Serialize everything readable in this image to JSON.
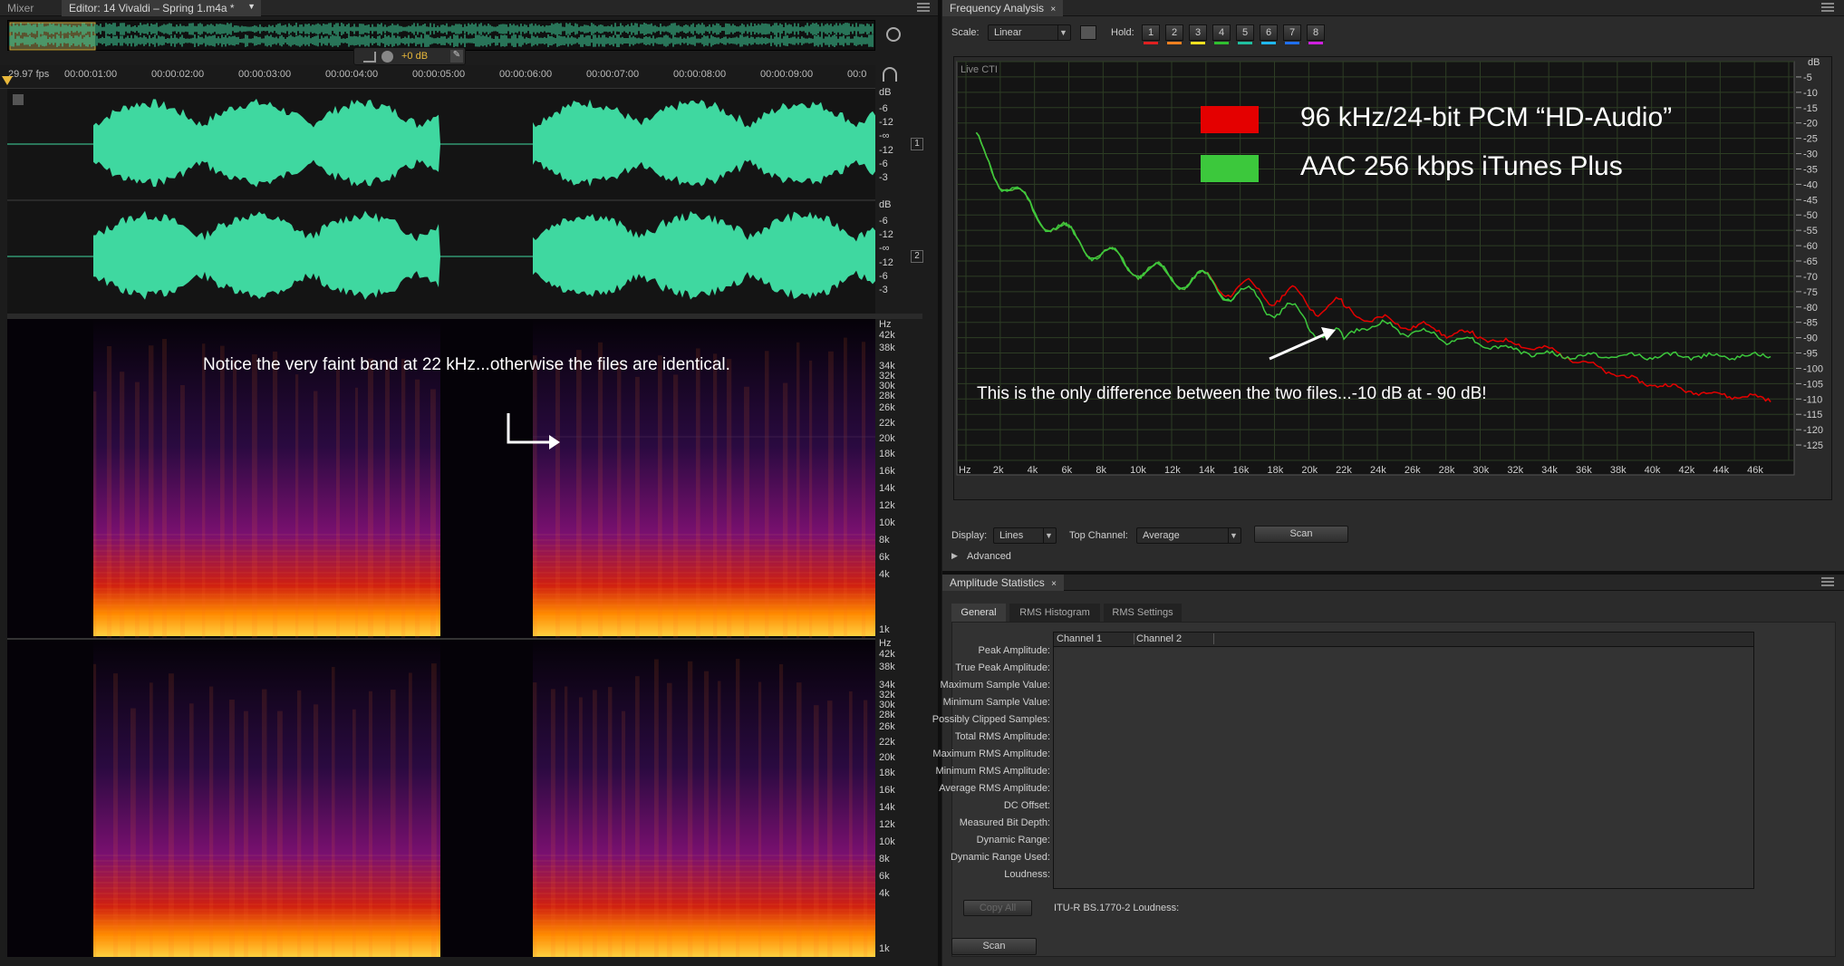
{
  "editor": {
    "tabs": [
      {
        "label": "Mixer"
      },
      {
        "label": "Editor: 14 Vivaldi – Spring 1.m4a *"
      }
    ],
    "hud_gain": "+0 dB",
    "fps_label": "29.97 fps",
    "timeline_labels": [
      "00:00:01:00",
      "00:00:02:00",
      "00:00:03:00",
      "00:00:04:00",
      "00:00:05:00",
      "00:00:06:00",
      "00:00:07:00",
      "00:00:08:00",
      "00:00:09:00",
      "00:0"
    ],
    "db_unit": "dB",
    "channel1_db_ticks": [
      "-6",
      "-12",
      "-∞",
      "-12",
      "-6",
      "-3"
    ],
    "channel2_db_ticks": [
      "-6",
      "-12",
      "-∞",
      "-12",
      "-6",
      "-3"
    ],
    "channel_badges": [
      "1",
      "2"
    ],
    "hz_unit": "Hz",
    "hz_ticks": [
      "42k",
      "38k",
      "34k",
      "32k",
      "30k",
      "28k",
      "26k",
      "22k",
      "20k",
      "18k",
      "16k",
      "14k",
      "12k",
      "10k",
      "8k",
      "6k",
      "4k",
      "1k"
    ],
    "annotation_text": "Notice the very faint band at 22 kHz...otherwise the files are identical."
  },
  "frequency_analysis": {
    "title": "Frequency Analysis",
    "scale_label": "Scale:",
    "scale_value": "Linear",
    "hold_label": "Hold:",
    "hold_buttons": [
      {
        "label": "1",
        "color": "#e02020"
      },
      {
        "label": "2",
        "color": "#f08020"
      },
      {
        "label": "3",
        "color": "#f0e020"
      },
      {
        "label": "4",
        "color": "#30c030"
      },
      {
        "label": "5",
        "color": "#20c0a0"
      },
      {
        "label": "6",
        "color": "#20b8f0"
      },
      {
        "label": "7",
        "color": "#2070f0"
      },
      {
        "label": "8",
        "color": "#d020e0"
      }
    ],
    "live_cti": "Live CTI",
    "legend": [
      {
        "label": "96 kHz/24-bit PCM “HD-Audio”",
        "color": "#e40000"
      },
      {
        "label": "AAC 256 kbps iTunes Plus",
        "color": "#3cc83c"
      }
    ],
    "annotation": "This is the only difference between the two files...-10 dB at - 90 dB!",
    "display_label": "Display:",
    "display_value": "Lines",
    "top_channel_label": "Top Channel:",
    "top_channel_value": "Average",
    "scan_label": "Scan",
    "advanced_label": "Advanced"
  },
  "chart_data": {
    "type": "line",
    "title": "",
    "xlabel": "",
    "ylabel": "dB",
    "x_unit_label": "Hz",
    "x_tick_labels": [
      "2k",
      "4k",
      "6k",
      "8k",
      "10k",
      "12k",
      "14k",
      "16k",
      "18k",
      "20k",
      "22k",
      "24k",
      "26k",
      "28k",
      "30k",
      "32k",
      "34k",
      "36k",
      "38k",
      "40k",
      "42k",
      "44k",
      "46k"
    ],
    "y_tick_labels": [
      "-5",
      "-10",
      "-15",
      "-20",
      "-25",
      "-30",
      "-35",
      "-40",
      "-45",
      "-50",
      "-55",
      "-60",
      "-65",
      "-70",
      "-75",
      "-80",
      "-85",
      "-90",
      "-95",
      "-100",
      "-105",
      "-110",
      "-115",
      "-120",
      "-125"
    ],
    "xlim": [
      0,
      48000
    ],
    "ylim": [
      -130,
      0
    ],
    "grid": true,
    "legend_position": "top-right",
    "series": [
      {
        "name": "96 kHz/24-bit PCM “HD-Audio”",
        "color": "#e40000",
        "x": [
          0,
          1000,
          2000,
          3000,
          4000,
          5000,
          6000,
          7000,
          8000,
          9000,
          10000,
          11000,
          12000,
          13000,
          14000,
          15000,
          16000,
          17000,
          18000,
          19000,
          20000,
          21000,
          22000,
          23000,
          24000,
          25000,
          26000,
          27000,
          28000,
          29000,
          30000,
          31000,
          32000,
          33000,
          34000,
          35000,
          36000,
          37000,
          38000,
          39000,
          40000,
          41000,
          42000,
          43000,
          44000,
          45000,
          46000,
          47000,
          48000
        ],
        "y": [
          -22,
          -30,
          -38,
          -44,
          -49,
          -53,
          -57,
          -60,
          -63,
          -65,
          -67,
          -69,
          -70,
          -71,
          -72,
          -73,
          -74,
          -75,
          -76,
          -77,
          -78,
          -80,
          -81,
          -83,
          -84,
          -85,
          -86,
          -87,
          -88,
          -89,
          -90,
          -91,
          -92,
          -93,
          -94,
          -96,
          -98,
          -100,
          -102,
          -104,
          -105,
          -106,
          -107,
          -108,
          -108.5,
          -109,
          -109.5,
          -110,
          -110.5
        ]
      },
      {
        "name": "AAC 256 kbps iTunes Plus",
        "color": "#3cc83c",
        "x": [
          0,
          1000,
          2000,
          3000,
          4000,
          5000,
          6000,
          7000,
          8000,
          9000,
          10000,
          11000,
          12000,
          13000,
          14000,
          15000,
          16000,
          17000,
          18000,
          19000,
          20000,
          21000,
          22000,
          23000,
          24000,
          25000,
          26000,
          27000,
          28000,
          29000,
          30000,
          31000,
          32000,
          33000,
          34000,
          35000,
          36000,
          37000,
          38000,
          39000,
          40000,
          41000,
          42000,
          43000,
          44000,
          45000,
          46000,
          47000,
          48000
        ],
        "y": [
          -22,
          -30,
          -38,
          -44,
          -49,
          -53,
          -57,
          -60,
          -63,
          -65,
          -67,
          -69,
          -70,
          -71,
          -72,
          -74,
          -76,
          -78,
          -80,
          -82,
          -85,
          -88,
          -92,
          -86,
          -86,
          -87,
          -88,
          -89,
          -90,
          -91,
          -92,
          -93,
          -94,
          -95,
          -95.5,
          -96,
          -96,
          -96,
          -96,
          -96,
          -96,
          -96,
          -96,
          -96,
          -96,
          -96,
          -96,
          -96,
          -96
        ]
      }
    ]
  },
  "amplitude_statistics": {
    "title": "Amplitude Statistics",
    "tabs": [
      "General",
      "RMS Histogram",
      "RMS Settings"
    ],
    "columns": [
      "Channel 1",
      "Channel 2"
    ],
    "rows": [
      "Peak Amplitude:",
      "True Peak Amplitude:",
      "Maximum Sample Value:",
      "Minimum Sample Value:",
      "Possibly Clipped Samples:",
      "Total RMS Amplitude:",
      "Maximum RMS Amplitude:",
      "Minimum RMS Amplitude:",
      "Average RMS Amplitude:",
      "DC Offset:",
      "Measured Bit Depth:",
      "Dynamic Range:",
      "Dynamic Range Used:",
      "Loudness:"
    ],
    "copy_all": "Copy All",
    "loudness_std": "ITU-R BS.1770-2 Loudness:",
    "scan_label": "Scan"
  }
}
